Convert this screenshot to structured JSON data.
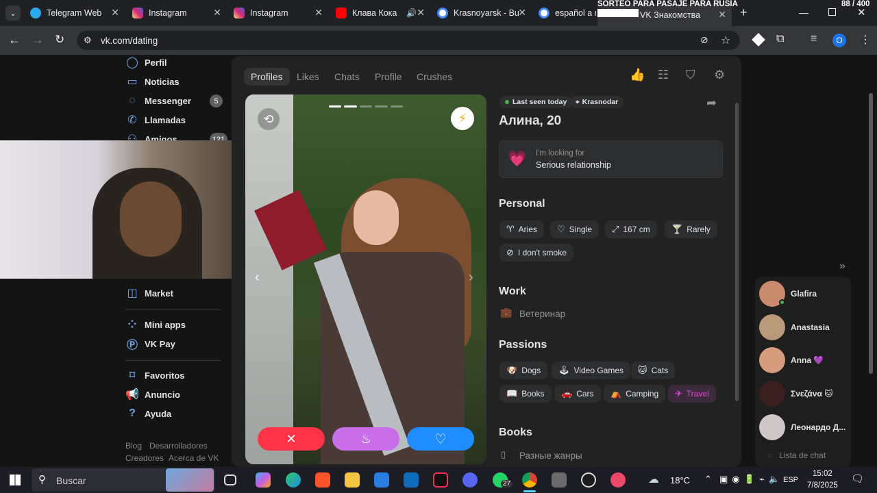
{
  "browser": {
    "tabs": [
      {
        "title": "Telegram Web",
        "color": "#2aabee"
      },
      {
        "title": "Instagram",
        "color": "#d62976"
      },
      {
        "title": "Instagram",
        "color": "#d62976"
      },
      {
        "title": "Клава Кока",
        "color": "#ff0000"
      },
      {
        "title": "Krasnoyarsk - Bu",
        "color": "#4285f4"
      },
      {
        "title": "español a ru",
        "color": "#4285f4"
      },
      {
        "title": "VK Знакомства",
        "color": "#0077ff"
      }
    ],
    "overlay_banner": "SORTEO PARA PASAJE PARA RUSIA",
    "counter": "88 / 400",
    "url": "vk.com/dating",
    "profile_initial": "O"
  },
  "sidebar": {
    "items": [
      {
        "label": "Perfil",
        "icon": "user-circle-icon"
      },
      {
        "label": "Noticias",
        "icon": "news-icon"
      },
      {
        "label": "Messenger",
        "icon": "chat-bubble-icon",
        "badge": "5"
      },
      {
        "label": "Llamadas",
        "icon": "phone-icon"
      },
      {
        "label": "Amigos",
        "icon": "friends-icon",
        "badge": "121"
      },
      {
        "label": "Market",
        "icon": "bag-icon"
      },
      {
        "label": "Mini apps",
        "icon": "grid-icon"
      },
      {
        "label": "VK Pay",
        "icon": "vkpay-icon"
      },
      {
        "label": "Favoritos",
        "icon": "bookmark-icon"
      },
      {
        "label": "Anuncio",
        "icon": "megaphone-icon"
      },
      {
        "label": "Ayuda",
        "icon": "help-icon"
      }
    ],
    "footer": [
      "Blog",
      "Desarrolladores",
      "Creadores",
      "Acerca de VK"
    ]
  },
  "dating": {
    "tabs": [
      "Profiles",
      "Likes",
      "Chats",
      "Profile",
      "Crushes"
    ],
    "active_tab": "Profiles",
    "status": {
      "last_seen": "Last seen today",
      "city": "Krasnodar"
    },
    "name": "Алина, 20",
    "looking_for": {
      "label": "I'm looking for",
      "value": "Serious relationship"
    },
    "personal": {
      "title": "Personal",
      "tags": [
        {
          "label": "Aries",
          "icon": "aries-icon"
        },
        {
          "label": "Single",
          "icon": "heart-outline-icon"
        },
        {
          "label": "167 cm",
          "icon": "height-arrows-icon"
        },
        {
          "label": "Rarely",
          "icon": "glass-icon"
        },
        {
          "label": "I don't smoke",
          "icon": "no-smoking-icon"
        }
      ]
    },
    "work": {
      "title": "Work",
      "value": "Ветеринар"
    },
    "passions": {
      "title": "Passions",
      "tags": [
        {
          "label": "Dogs",
          "icon": "🐶"
        },
        {
          "label": "Video Games",
          "icon": "🕹"
        },
        {
          "label": "Cats",
          "icon": "🐱"
        },
        {
          "label": "Books",
          "icon": "📖"
        },
        {
          "label": "Cars",
          "icon": "🚗"
        },
        {
          "label": "Camping",
          "icon": "⛺"
        },
        {
          "label": "Travel",
          "icon": "✈",
          "highlight": true
        }
      ]
    },
    "books": {
      "title": "Books",
      "value": "Разные жанры"
    }
  },
  "chats": [
    {
      "name": "Glafira",
      "color": "#c98a6e",
      "online": true
    },
    {
      "name": "Anastasia",
      "color": "#b89a7a"
    },
    {
      "name": "Anna 💜",
      "color": "#d79b7d"
    },
    {
      "name": "Σνεζάνα 🐱",
      "color": "#3a1f1f"
    },
    {
      "name": "Леонардо Д...",
      "color": "#cfc7c7"
    }
  ],
  "chat_list_label": "Lista de chat",
  "taskbar": {
    "search_placeholder": "Buscar",
    "weather": "18°C",
    "whatsapp_badge": "27",
    "lang": "ESP",
    "time": "15:02",
    "date": "7/8/2025"
  }
}
